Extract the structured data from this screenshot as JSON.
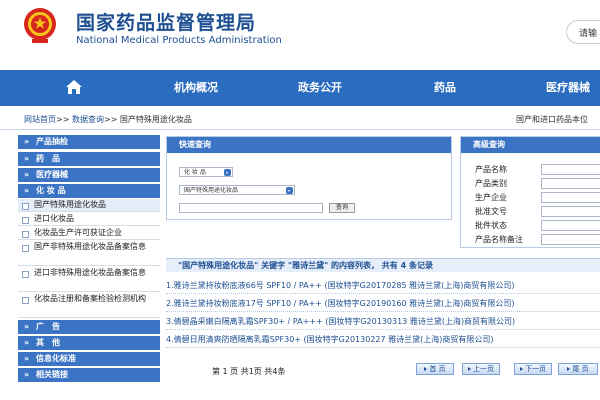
{
  "header": {
    "title_cn": "国家药品监督管理局",
    "title_en": "National Medical Products Administration",
    "login_label": "请输"
  },
  "nav": {
    "home_icon": "home-icon",
    "items": [
      "机构概况",
      "政务公开",
      "药品",
      "医疗器械"
    ]
  },
  "breadcrumb": {
    "home": "网站首页",
    "sep1": ">>",
    "query": "数据查询",
    "sep2": ">>",
    "current": "国产特殊用途化妆品",
    "right_text": "国产和进口药品本位"
  },
  "sidebar": {
    "heads": [
      "产品抽检",
      "药　品",
      "医疗器械",
      "化 妆 品",
      "广　告",
      "其　他",
      "信息化标准",
      "相关链接"
    ],
    "sub_items": [
      "国产特殊用途化妆品",
      "进口化妆品",
      "化妆品生产许可获证企业",
      "国产非特殊用途化妆品备案信息",
      "进口非特殊用途化妆品备案信息",
      "化妆品注册和备案检验检测机构"
    ]
  },
  "quick_search": {
    "title": "快速查询",
    "category_value": "化 妆 品",
    "database_value": "国产特殊用途化妆品",
    "input_value": "",
    "search_button": "查询"
  },
  "advanced_search": {
    "title": "高级查询",
    "fields": [
      "产品名称",
      "产品类别",
      "生产企业",
      "批准文号",
      "批件状态",
      "产品名称备注"
    ]
  },
  "results": {
    "summary": "\"国产特殊用途化妆品\" 关键字 \"雅诗兰黛\" 的内容列表， 共有 4 条记录",
    "items": [
      "1.雅诗兰黛持妆粉底液66号 SPF10 / PA++ (国妆特字G20170285 雅诗兰黛(上海)商贸有限公司)",
      "2.雅诗兰黛持妆粉底液17号 SPF10 / PA++ (国妆特字G20190160 雅诗兰黛(上海)商贸有限公司)",
      "3.倩碧晶采嫩白隔离乳霜SPF30+ / PA+++ (国妆特字G20130313 雅诗兰黛(上海)商贸有限公司)",
      "4.倩碧日用清爽防晒隔离乳霜SPF30+ (国妆特字G20130227 雅诗兰黛(上海)商贸有限公司)"
    ]
  },
  "pagination": {
    "info": "第 1 页 共1页 共4条",
    "first": "首 页",
    "prev": "上一页",
    "next": "下一页",
    "last": "尾 页"
  },
  "colors": {
    "brand_blue": "#2a6cbf",
    "panel_header": "#3b74c4",
    "link_blue": "#1d4f91"
  }
}
